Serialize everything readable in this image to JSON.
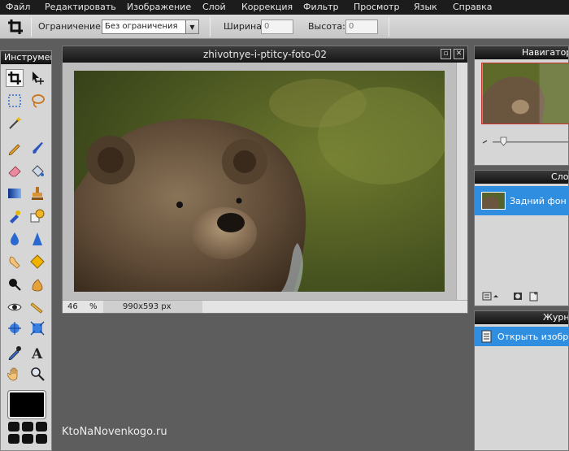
{
  "menu": [
    "Файл",
    "Редактировать",
    "Изображение",
    "Слой",
    "Коррекция",
    "Фильтр",
    "Просмотр",
    "Язык",
    "Справка"
  ],
  "options": {
    "constraint_label": "Ограничение:",
    "constraint_value": "Без ограничения",
    "width_label": "Ширина:",
    "width_value": "0",
    "height_label": "Высота:",
    "height_value": "0"
  },
  "tools_panel": {
    "title": "Инструменты"
  },
  "image_window": {
    "title": "zhivotnye-i-ptitcy-foto-02",
    "zoom": "46",
    "zoom_unit": "%",
    "dimensions": "990x593 px"
  },
  "navigator_panel": {
    "title": "Навигатор"
  },
  "layers_panel": {
    "title": "Слои",
    "layers": [
      {
        "name": "Задний фон"
      }
    ]
  },
  "history_panel": {
    "title": "Журнал",
    "items": [
      {
        "label": "Открыть изображение"
      }
    ]
  },
  "watermark": "KtoNaNovenkogo.ru",
  "colors": {
    "accent": "#2f8ee0",
    "menubar": "#1c1c1c",
    "workspace": "#5d5d5d"
  },
  "icons": [
    "crop-icon",
    "move-icon",
    "marquee-icon",
    "lasso-icon",
    "magic-wand-icon",
    "pencil-icon",
    "brush-icon",
    "eraser-icon",
    "paint-bucket-icon",
    "gradient-icon",
    "clone-stamp-icon",
    "color-replace-icon",
    "shape-icon",
    "blur-icon",
    "sharpen-icon",
    "smudge-icon",
    "sponge-icon",
    "dodge-icon",
    "burn-icon",
    "red-eye-icon",
    "bloat-icon",
    "pinch-icon",
    "eyedropper-icon",
    "type-icon",
    "hand-icon",
    "zoom-icon"
  ]
}
